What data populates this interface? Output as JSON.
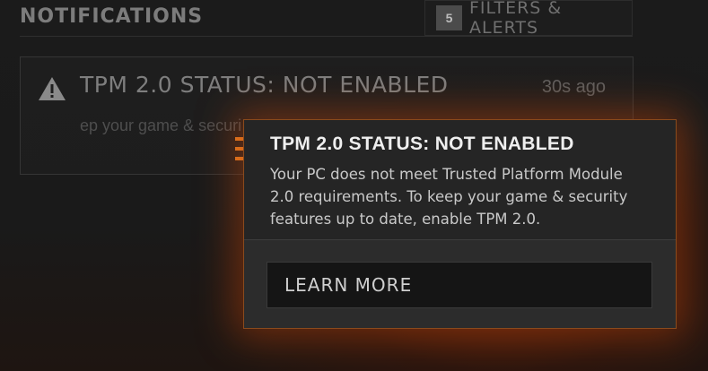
{
  "header": {
    "title": "NOTIFICATIONS",
    "filters_count": "5",
    "filters_label": "FILTERS & ALERTS"
  },
  "notification": {
    "icon": "warning-icon",
    "title": "TPM 2.0 STATUS: NOT ENABLED",
    "time": "30s ago",
    "body_preview": "ep your game & securit"
  },
  "popup": {
    "title": "TPM 2.0 STATUS: NOT ENABLED",
    "description": "Your PC does not meet Trusted Platform Module 2.0 requirements. To keep your game & security features up to date, enable TPM 2.0.",
    "button_label": "LEARN MORE"
  },
  "colors": {
    "accent": "#e07a22",
    "popup_border": "#8a4a1c",
    "background": "#1a1a1a"
  }
}
